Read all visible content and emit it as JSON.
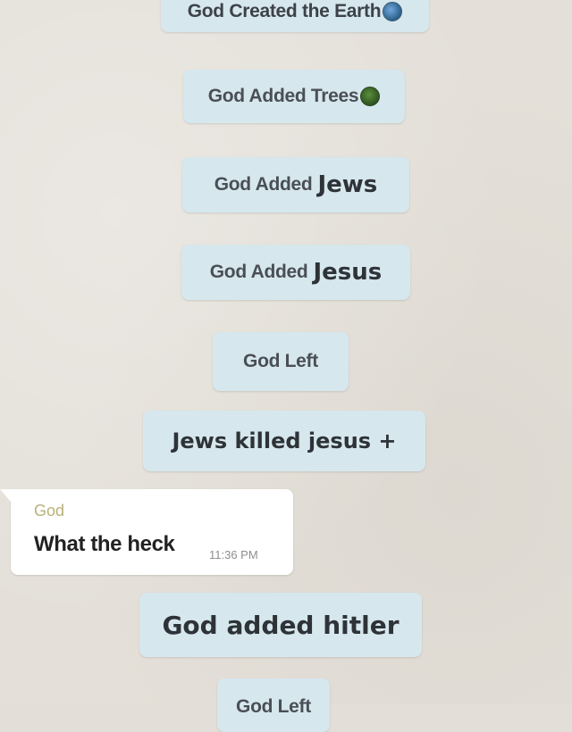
{
  "messages": {
    "created_earth": "God Created the Earth",
    "added_trees": "God Added Trees",
    "added_jews_prefix": "God Added",
    "added_jews_name": "Jews",
    "added_jesus_prefix": "God Added",
    "added_jesus_name": "Jesus",
    "god_left": "God Left",
    "jews_killed": "Jews killed jesus +",
    "added_hitler": "God added hitler",
    "partial_bottom": "God Left"
  },
  "incoming": {
    "sender": "God",
    "text": "What the heck",
    "time": "11:36 PM"
  },
  "icons": {
    "earth": "earth-globe-icon",
    "trees": "tree-icon"
  },
  "colors": {
    "system_bubble": "#d6e7ee",
    "incoming_bubble": "#ffffff",
    "background": "#e4e0d9",
    "sender_name": "#b9b07a"
  }
}
